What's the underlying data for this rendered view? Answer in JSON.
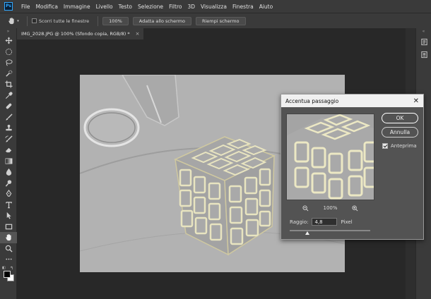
{
  "app": {
    "logo_text": "Ps",
    "menu": [
      "File",
      "Modifica",
      "Immagine",
      "Livello",
      "Testo",
      "Selezione",
      "Filtro",
      "3D",
      "Visualizza",
      "Finestra",
      "Aiuto"
    ]
  },
  "options_bar": {
    "scroll_all_label": "Scorri tutte le finestre",
    "zoom_100_label": "100%",
    "fit_screen_label": "Adatta allo schermo",
    "fill_screen_label": "Riempi schermo"
  },
  "document_tab": {
    "title": "IMG_2028.JPG @ 100% (Sfondo copia, RGB/8) *",
    "close_glyph": "×"
  },
  "dialog": {
    "title": "Accentua passaggio",
    "close_glyph": "✕",
    "ok_label": "OK",
    "cancel_label": "Annulla",
    "preview_label": "Anteprima",
    "preview_checked": true,
    "zoom_level": "100%",
    "radius_label": "Raggio:",
    "radius_value": "4,8",
    "radius_unit": "Pixel",
    "slider_fraction": 0.22
  },
  "colors": {
    "ui_dark": "#3a3a3a",
    "workspace": "#282828",
    "dialog_bg": "#535353",
    "ps_accent": "#31a8ff",
    "foreground_swatch": "#000000",
    "background_swatch": "#ffffff"
  },
  "icons": {
    "toolbar": [
      "move-icon",
      "marquee-icon",
      "lasso-icon",
      "quick-selection-icon",
      "crop-icon",
      "eyedropper-icon",
      "healing-brush-icon",
      "brush-icon",
      "clone-stamp-icon",
      "history-brush-icon",
      "eraser-icon",
      "gradient-icon",
      "blur-icon",
      "dodge-icon",
      "pen-icon",
      "type-icon",
      "path-selection-icon",
      "rectangle-icon",
      "hand-icon",
      "zoom-icon",
      "more-tools-icon"
    ]
  }
}
